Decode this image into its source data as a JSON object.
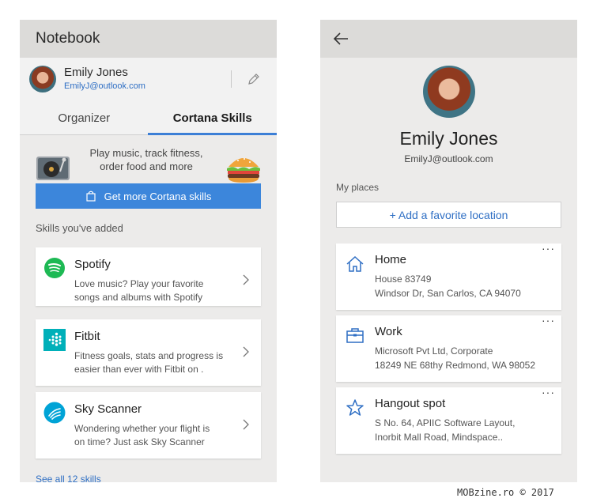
{
  "left_panel": {
    "header_title": "Notebook",
    "user": {
      "name": "Emily Jones",
      "email": "EmilyJ@outlook.com"
    },
    "tabs": [
      {
        "label": "Organizer",
        "active": false
      },
      {
        "label": "Cortana Skills",
        "active": true
      }
    ],
    "promo": {
      "text_line1": "Play music, track fitness,",
      "text_line2": "order food and more",
      "button_label": "Get more Cortana skills"
    },
    "section_label": "Skills you've added",
    "skills": [
      {
        "title": "Spotify",
        "desc_line1": "Love music? Play your favorite",
        "desc_line2": "songs and albums with Spotify",
        "icon": "spotify-icon"
      },
      {
        "title": "Fitbit",
        "desc_line1": "Fitness goals, stats and progress is",
        "desc_line2": "easier than ever with Fitbit on .",
        "icon": "fitbit-icon"
      },
      {
        "title": "Sky Scanner",
        "desc_line1": "Wondering whether your flight is",
        "desc_line2": "on time? Just ask Sky Scanner",
        "icon": "skyscanner-icon"
      }
    ],
    "see_all_label": "See all 12 skills"
  },
  "right_panel": {
    "profile": {
      "name": "Emily Jones",
      "email": "EmilyJ@outlook.com"
    },
    "places_label": "My places",
    "add_favorite_label": "+ Add a favorite location",
    "places": [
      {
        "title": "Home",
        "line1": "House 83749",
        "line2": "Windsor Dr, San Carlos, CA 94070",
        "icon": "home-icon"
      },
      {
        "title": "Work",
        "line1": "Microsoft Pvt Ltd, Corporate",
        "line2": "18249 NE 68thy Redmond, WA 98052",
        "icon": "briefcase-icon"
      },
      {
        "title": "Hangout spot",
        "line1": "S No. 64, APIIC Software Layout,",
        "line2": "Inorbit Mall Road, Mindspace..",
        "icon": "star-icon"
      }
    ],
    "more_label": "···"
  },
  "watermark": "MOBzine.ro © 2017",
  "colors": {
    "accent": "#3c86db",
    "link": "#2f6fc4",
    "spotify": "#1db954",
    "fitbit": "#00b0b9",
    "skyscanner": "#00a3d6"
  }
}
